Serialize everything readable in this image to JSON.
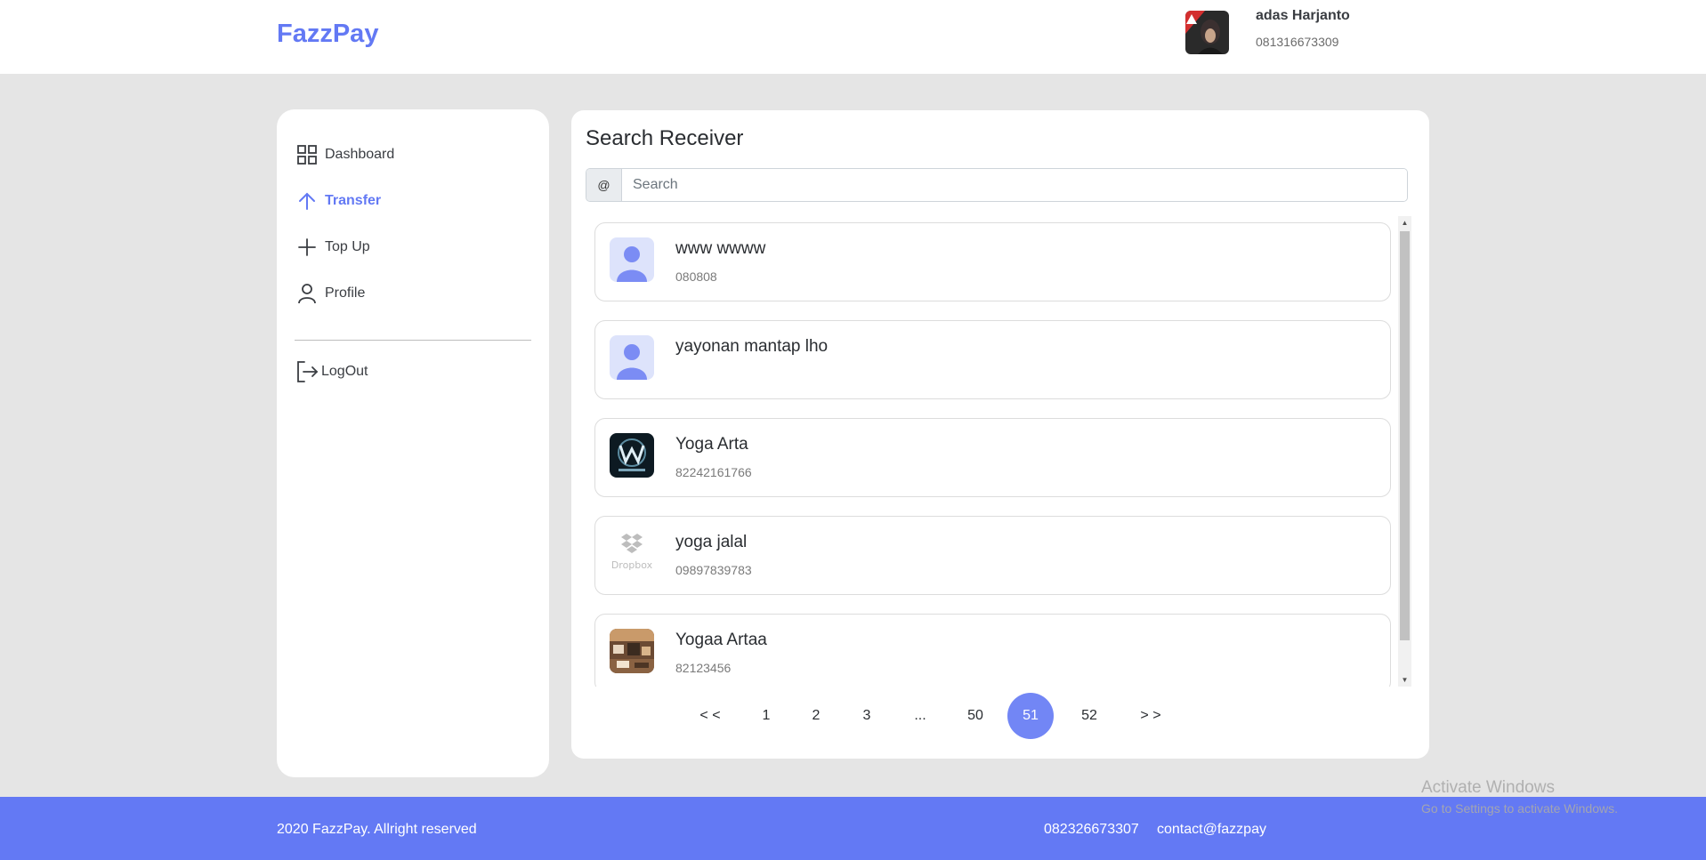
{
  "header": {
    "brand": "FazzPay",
    "user_name": "adas Harjanto",
    "user_phone": "081316673309"
  },
  "sidebar": {
    "items": [
      {
        "label": "Dashboard",
        "icon": "grid-icon"
      },
      {
        "label": "Transfer",
        "icon": "arrow-up-icon",
        "active": true
      },
      {
        "label": "Top Up",
        "icon": "plus-icon"
      },
      {
        "label": "Profile",
        "icon": "user-icon"
      }
    ],
    "logout_label": "LogOut"
  },
  "main": {
    "title": "Search Receiver",
    "search_prefix": "@",
    "search_placeholder": "Search",
    "receivers": [
      {
        "name": "www wwww",
        "phone": "080808",
        "avatar": "default-avatar"
      },
      {
        "name": "yayonan mantap lho",
        "phone": "",
        "avatar": "default-avatar"
      },
      {
        "name": "Yoga Arta",
        "phone": "82242161766",
        "avatar": "westworld-logo"
      },
      {
        "name": "yoga jalal",
        "phone": "09897839783",
        "avatar": "dropbox-logo"
      },
      {
        "name": "Yogaa Artaa",
        "phone": "82123456",
        "avatar": "photo"
      }
    ],
    "pagination": {
      "prev": "< <",
      "pages": [
        "1",
        "2",
        "3",
        "...",
        "50",
        "51",
        "52"
      ],
      "current": "51",
      "next": "> >"
    }
  },
  "footer": {
    "copyright": "2020 FazzPay. Allright reserved",
    "phone": "082326673307",
    "email": "contact@fazzpay"
  },
  "watermark": {
    "line1": "Activate Windows",
    "line2": "Go to Settings to activate Windows."
  },
  "colors": {
    "accent": "#6379f4",
    "background": "#e5e5e5"
  }
}
